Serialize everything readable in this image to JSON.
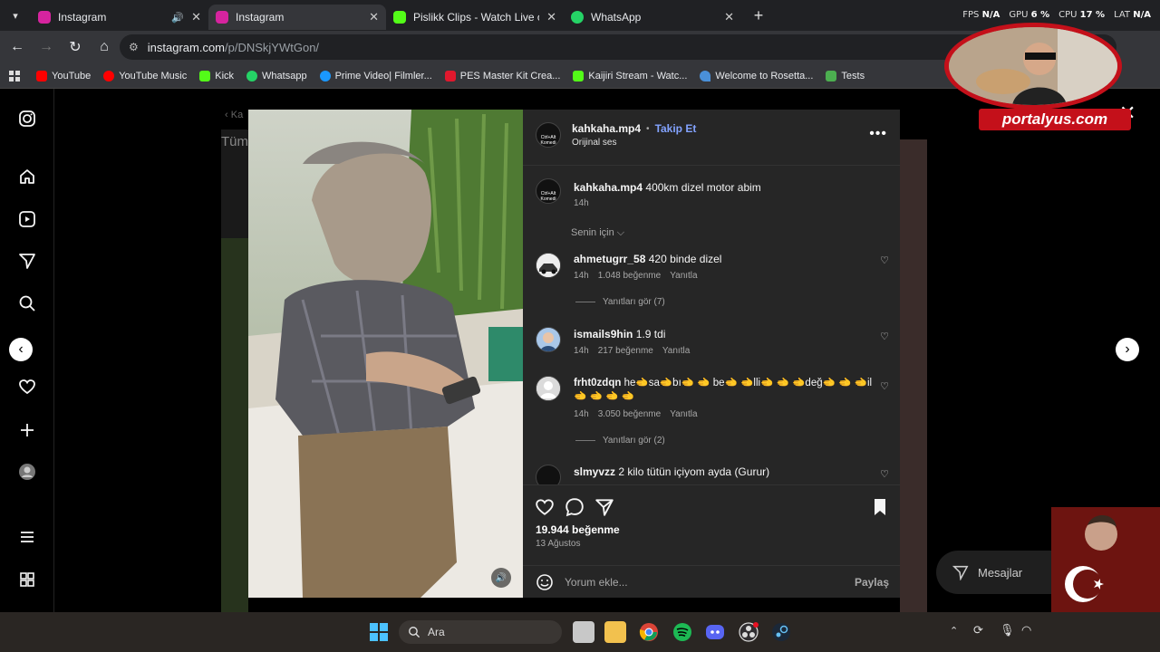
{
  "browser": {
    "tabs": [
      {
        "title": "Instagram",
        "favicon_color": "#d6249f",
        "audio": true,
        "active": false
      },
      {
        "title": "Instagram",
        "favicon_color": "#d6249f",
        "active": true
      },
      {
        "title": "Pislikk Clips - Watch Live on Kic",
        "favicon_color": "#53fc18",
        "active": false
      },
      {
        "title": "WhatsApp",
        "favicon_color": "#25d366",
        "active": false
      }
    ],
    "perf": {
      "fps_label": "FPS",
      "fps": "N/A",
      "gpu_label": "GPU",
      "gpu": "6 %",
      "cpu_label": "CPU",
      "cpu": "17 %",
      "lat_label": "LAT",
      "lat": "N/A"
    },
    "url_host": "instagram.com",
    "url_path": "/p/DNSkjYWtGon/",
    "bookmarks": [
      {
        "label": "YouTube",
        "color": "#ff0000"
      },
      {
        "label": "YouTube Music",
        "color": "#ff0000"
      },
      {
        "label": "Kick",
        "color": "#53fc18"
      },
      {
        "label": "Whatsapp",
        "color": "#25d366"
      },
      {
        "label": "Prime Video| Filmler...",
        "color": "#1a98ff"
      },
      {
        "label": "PES Master Kit Crea...",
        "color": "#e0182d"
      },
      {
        "label": "Kaijiri Stream - Watc...",
        "color": "#53fc18"
      },
      {
        "label": "Welcome to Rosetta...",
        "color": "#4a90d9"
      },
      {
        "label": "Tests",
        "color": "#4caf50"
      }
    ]
  },
  "background": {
    "heading": "Tüm",
    "back_text": "Ka"
  },
  "post": {
    "author": "kahkaha.mp4",
    "follow": "Takip Et",
    "audio": "Orijinal ses",
    "caption": "400km dizel motor abim",
    "caption_time": "14h",
    "for_you": "Senin için",
    "avatar_text": "Ctrl+Alt Komedi",
    "comments": [
      {
        "user": "ahmetugrr_58",
        "text": "420 binde dizel",
        "time": "14h",
        "likes": "1.048 beğenme",
        "reply": "Yanıtla",
        "view_replies": "Yanıtları gör (7)"
      },
      {
        "user": "ismails9hin",
        "text": "1.9 tdi",
        "time": "14h",
        "likes": "217 beğenme",
        "reply": "Yanıtla"
      },
      {
        "user": "frht0zdqn",
        "text": "he🫲sa🫲bı🫲 🫲 be🫲 🫲lli🫲 🫲 🫲değ🫲 🫲 🫲il🫲 🫲 🫲 🫲",
        "time": "14h",
        "likes": "3.050 beğenme",
        "reply": "Yanıtla",
        "view_replies": "Yanıtları gör (2)"
      },
      {
        "user": "slmyvzz",
        "text": "2 kilo tütün içiyom ayda (Gurur)"
      }
    ],
    "like_count": "19.944 beğenme",
    "date": "13 Ağustos",
    "comment_placeholder": "Yorum ekle...",
    "share": "Paylaş"
  },
  "messages": "Mesajlar",
  "overlay": {
    "logo": "portalyus.com"
  },
  "taskbar": {
    "search": "Ara"
  }
}
